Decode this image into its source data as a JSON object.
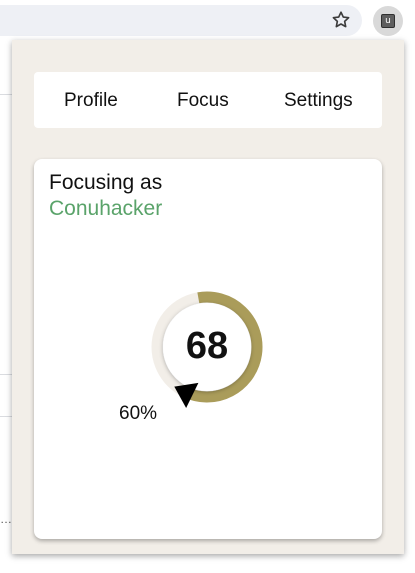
{
  "browser": {
    "bookmark_icon": "star-outline-icon",
    "extension_badge": "u"
  },
  "popup": {
    "nav": {
      "items": [
        {
          "label": "Profile"
        },
        {
          "label": "Focus"
        },
        {
          "label": "Settings"
        }
      ]
    },
    "focus": {
      "label": "Focusing as",
      "user_name": "Conuhacker",
      "score": "68",
      "progress_text": "60%",
      "progress_fraction": 0.6,
      "colors": {
        "ring": "#aa9c5a",
        "name": "#5aa36a",
        "pointer": "#000000"
      }
    }
  }
}
